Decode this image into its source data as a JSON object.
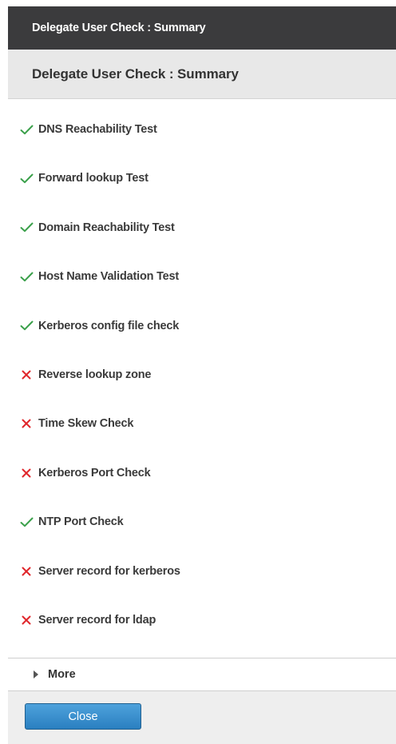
{
  "window": {
    "title": "Delegate User Check : Summary"
  },
  "section": {
    "title": "Delegate User Check : Summary"
  },
  "checks": [
    {
      "label": "DNS Reachability Test",
      "status": "pass",
      "icon": "check-icon"
    },
    {
      "label": "Forward lookup Test",
      "status": "pass",
      "icon": "check-icon"
    },
    {
      "label": "Domain Reachability Test",
      "status": "pass",
      "icon": "check-icon"
    },
    {
      "label": "Host Name Validation Test",
      "status": "pass",
      "icon": "check-icon"
    },
    {
      "label": "Kerberos config file check",
      "status": "pass",
      "icon": "check-icon"
    },
    {
      "label": "Reverse lookup zone",
      "status": "fail",
      "icon": "cross-icon"
    },
    {
      "label": "Time Skew Check",
      "status": "fail",
      "icon": "cross-icon"
    },
    {
      "label": "Kerberos Port Check",
      "status": "fail",
      "icon": "cross-icon"
    },
    {
      "label": "NTP Port Check",
      "status": "pass",
      "icon": "check-icon"
    },
    {
      "label": "Server record for kerberos",
      "status": "fail",
      "icon": "cross-icon"
    },
    {
      "label": "Server record for ldap",
      "status": "fail",
      "icon": "cross-icon"
    }
  ],
  "more": {
    "label": "More",
    "icon": "expand-arrow-icon"
  },
  "footer": {
    "close_label": "Close"
  },
  "colors": {
    "pass": "#3aa04a",
    "fail": "#e0262b",
    "titlebar": "#3b3b3d",
    "button": "#3a8fd0"
  }
}
